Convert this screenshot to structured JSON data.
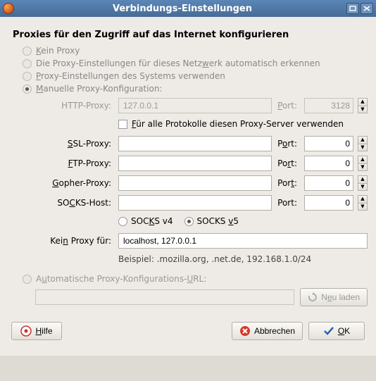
{
  "window": {
    "title": "Verbindungs-Einstellungen"
  },
  "heading": "Proxies für den Zugriff auf das Internet konfigurieren",
  "radios": {
    "no_proxy": "Kein Proxy",
    "auto_detect": "Die Proxy-Einstellungen für dieses Netzwerk automatisch erkennen",
    "system": "Proxy-Einstellungen des Systems verwenden",
    "manual": "Manuelle Proxy-Konfiguration:",
    "auto_url": "Automatische Proxy-Konfigurations-URL:"
  },
  "labels": {
    "http": "HTTP-Proxy:",
    "ssl": "SSL-Proxy:",
    "ftp": "FTP-Proxy:",
    "gopher": "Gopher-Proxy:",
    "socks": "SOCKS-Host:",
    "no_proxy_for": "Kein Proxy für:",
    "port": "Port:"
  },
  "values": {
    "http_host": "127.0.0.1",
    "http_port": "3128",
    "ssl_host": "",
    "ssl_port": "0",
    "ftp_host": "",
    "ftp_port": "0",
    "gopher_host": "",
    "gopher_port": "0",
    "socks_host": "",
    "socks_port": "0",
    "no_proxy_for": "localhost, 127.0.0.1",
    "auto_url": ""
  },
  "checkbox": {
    "use_for_all": "Für alle Protokolle diesen Proxy-Server verwenden"
  },
  "socks": {
    "v4": "SOCKS v4",
    "v5": "SOCKS v5"
  },
  "example": "Beispiel: .mozilla.org, .net.de, 192.168.1.0/24",
  "buttons": {
    "reload": "Neu laden",
    "help": "Hilfe",
    "cancel": "Abbrechen",
    "ok": "OK"
  }
}
